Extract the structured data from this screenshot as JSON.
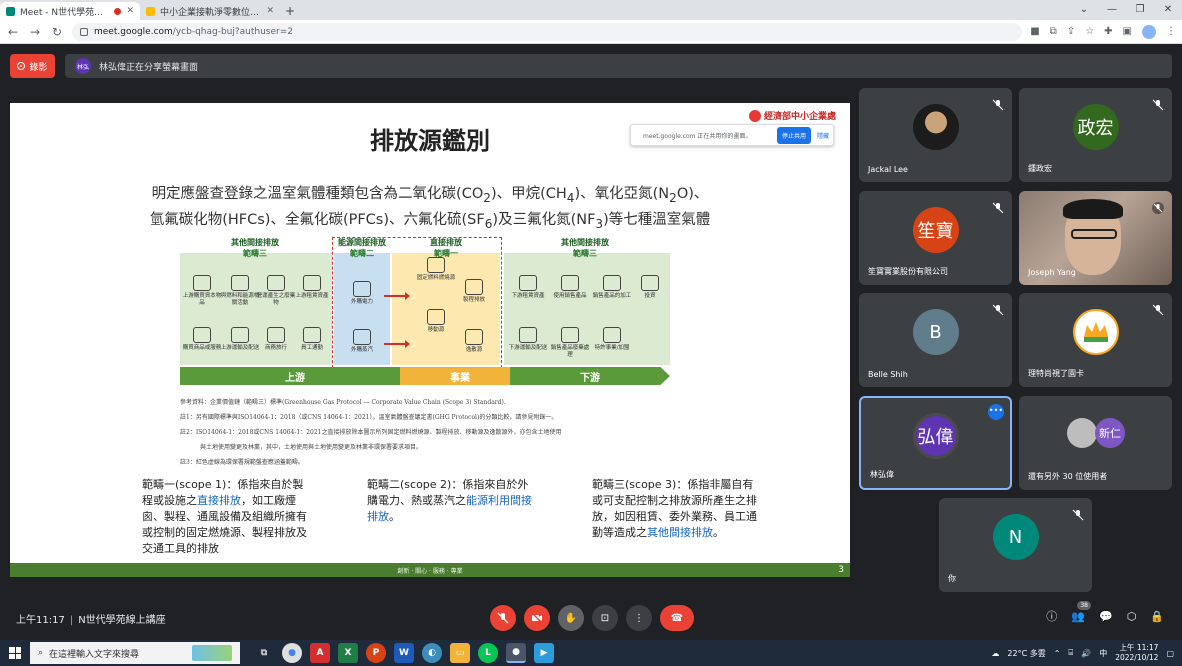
{
  "browser": {
    "tabs": [
      {
        "title": "Meet - N世代學苑線上講座",
        "active": true
      },
      {
        "title": "中小企業接軌淨零數位成長-公司",
        "active": false
      }
    ],
    "url_host": "meet.google.com",
    "url_path": "/ycb-qhag-buj?authuser=2"
  },
  "meet": {
    "record_label": "錄影",
    "presenter_initials": "林弘",
    "presenting_text": "林弘偉正在分享螢幕畫面",
    "meeting_time": "上午11:17",
    "meeting_name": "N世代學苑線上講座",
    "participant_count": "38"
  },
  "share_popup": {
    "text": "meet.google.com 正在共用你的畫面。",
    "stop_label": "停止共用",
    "hide_label": "隱藏"
  },
  "slide": {
    "title": "排放源鑑別",
    "logo_text": "經濟部中小企業處",
    "intro_line1_a": "明定應盤查登錄之溫室氣體種類包含為二氧化碳(CO",
    "intro_line1_b": ")、甲烷(CH",
    "intro_line1_c": ")、氧化亞氮(N",
    "intro_line1_d": "O)、",
    "intro_line2_a": "氫氟碳化物(HFCs)、全氟化碳(PFCs)、六氟化硫(SF",
    "intro_line2_b": ")及三氟化氮(NF",
    "intro_line2_c": ")等七種溫室氣體",
    "sub_2": "2",
    "sub_4": "4",
    "sub_6": "6",
    "sub_3": "3",
    "diagram": {
      "left_head": "其他間接排放",
      "left_sub": "範疇三",
      "energy_head": "能源間接排放",
      "energy_sub": "範疇二",
      "direct_head": "直接排放",
      "direct_sub": "範疇一",
      "right_head": "其他間接排放",
      "right_sub": "範疇三",
      "upstream_items": [
        "上游購買資本物品",
        "與燃料和能源相關活動",
        "營運產生之廢棄物",
        "上游租賃資產",
        "購買商品或服務",
        "上游運輸及配送",
        "商務旅行",
        "員工通勤"
      ],
      "energy_items": [
        "外購電力",
        "外購蒸汽"
      ],
      "direct_items": [
        "固定燃料燃燒源",
        "製程排放",
        "移動源",
        "逸散源"
      ],
      "downstream_items": [
        "下游租賃資產",
        "使用銷售產品",
        "銷售產品的加工",
        "投資",
        "下游運輸及配送",
        "銷售產品廢棄處理",
        "特許事業/加盟"
      ],
      "bar_upstream": "上游",
      "bar_business": "事業",
      "bar_downstream": "下游"
    },
    "refs": {
      "line1": "參考資料：企業價值鏈（範疇三）標準(Greenhouse Gas Protocol — Corporate Value Chain (Scope 3) Standard).",
      "line2": "註1：另有國際標準與ISO14064-1：2018（或CNS 14064-1：2021），溫室氣體盤查議定書(GHG Protocol)的分類比較，請參見附錄一。",
      "line3": "註2：ISO14064-1：2018或CNS 14064-1：2021之直接排放除本圖示所列固定燃料燃燒源、製程排放、移動源及逸散源外，亦包含土地使用",
      "line4": "與土地使用變更及林業，其中，土地使用與土地使用變更及林業非環保署要求項目。",
      "line5": "註3：紅色虛線為環保署規範盤查應涵蓋範疇。"
    },
    "scope1": {
      "pre": "範疇一(scope 1)：係指來自於製程或設施之",
      "hl": "直接排放",
      "post": "，如工廠煙囪、製程、通風設備及組織所擁有或控制的固定燃燒源、製程排放及交通工具的排放"
    },
    "scope2": {
      "pre": "範疇二(scope 2)：係指來自於外購電力、熱或蒸汽之",
      "hl": "能源利用間接排放",
      "post": "。"
    },
    "scope3": {
      "pre": "範疇三(scope 3)：係指非屬自有或可支配控制之排放源所產生之排放，如因租賃、委外業務、員工通勤等造成之",
      "hl": "其他間接排放",
      "post": "。"
    },
    "footer": "創新 · 關心 · 服務 · 專業",
    "page_number": "3"
  },
  "participants": [
    {
      "name": "Jackal Lee",
      "type": "photo"
    },
    {
      "name": "鍾政宏",
      "initials": "政宏",
      "color": "#33691e"
    },
    {
      "name": "笙寶實業股份有限公司",
      "initials": "笙寶",
      "color": "#d84315"
    },
    {
      "name": "Joseph Yang",
      "type": "video"
    },
    {
      "name": "Belle Shih",
      "initials": "B",
      "color": "#607d8b"
    },
    {
      "name": "理特尚視了園卡",
      "type": "logo"
    },
    {
      "name": "林弘偉",
      "initials": "弘偉",
      "color": "#5e35b1",
      "active": true
    },
    {
      "name": "還有另外 30 位使用者",
      "initials": "新仁",
      "color": "#7e57c2"
    },
    {
      "name": "你",
      "initials": "N",
      "color": "#00897b"
    }
  ],
  "taskbar": {
    "search_placeholder": "在這裡輸入文字來搜尋",
    "weather": "22°C 多雲",
    "ime": "中",
    "time": "上午 11:17",
    "date": "2022/10/12"
  }
}
